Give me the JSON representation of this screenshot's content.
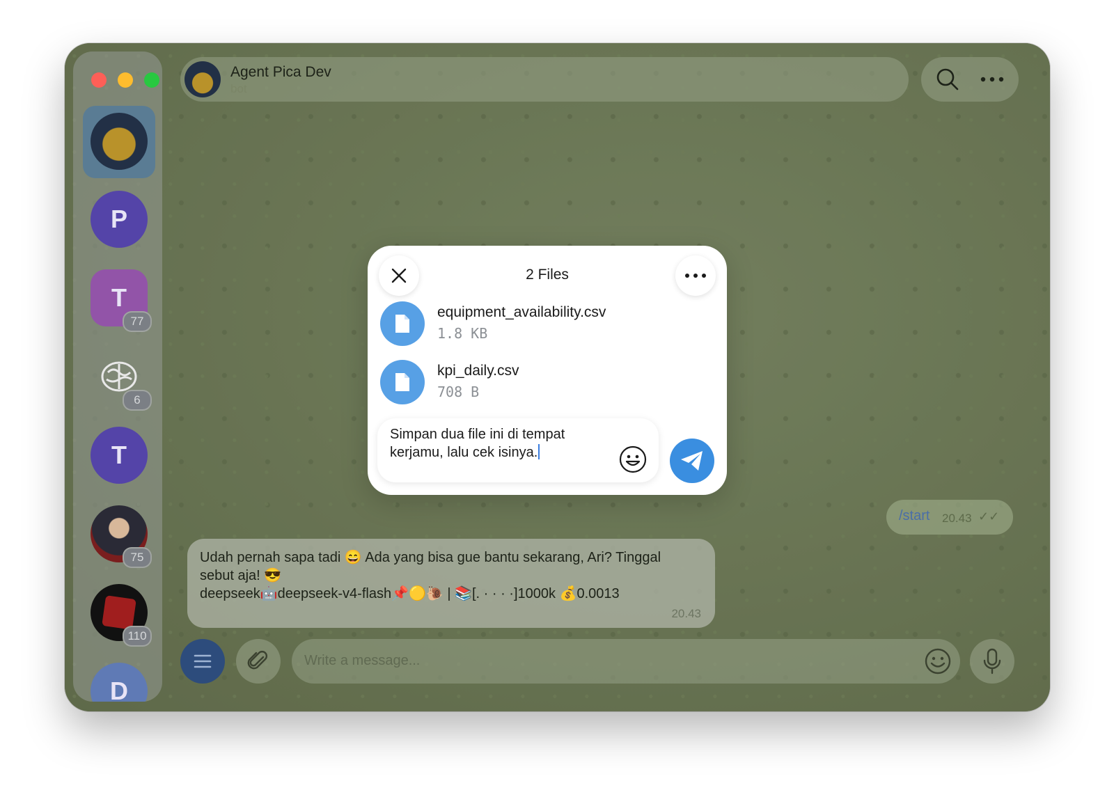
{
  "header": {
    "title": "Agent Pica Dev",
    "subtitle": "bot"
  },
  "sidebar": {
    "items": [
      {
        "name": "Agent Pica Dev",
        "letter": "",
        "badge": ""
      },
      {
        "name": "P",
        "letter": "P",
        "badge": ""
      },
      {
        "name": "T",
        "letter": "T",
        "badge": "77"
      },
      {
        "name": "brain",
        "letter": "",
        "badge": "6"
      },
      {
        "name": "T",
        "letter": "T",
        "badge": ""
      },
      {
        "name": "man",
        "letter": "",
        "badge": "75"
      },
      {
        "name": "dota",
        "letter": "",
        "badge": "110"
      },
      {
        "name": "D",
        "letter": "D",
        "badge": ""
      }
    ]
  },
  "messages": {
    "outgoing": {
      "text": "/start",
      "time": "20.43"
    },
    "incoming": {
      "line1": "Udah pernah sapa tadi 😄 Ada yang bisa gue bantu sekarang, Ari? Tinggal",
      "line2": "sebut aja! 😎",
      "line3": "deepseek🤖deepseek-v4-flash📌🟡🐌 | 📚[.  · · · ·]1000k 💰0.0013",
      "time": "20.43"
    }
  },
  "composer": {
    "placeholder": "Write a message..."
  },
  "modal": {
    "title": "2 Files",
    "files": [
      {
        "name": "equipment_availability.csv",
        "size": "1.8 KB"
      },
      {
        "name": "kpi_daily.csv",
        "size": "708 B"
      }
    ],
    "caption_line1": "Simpan dua file ini di tempat",
    "caption_line2": "kerjamu, lalu cek isinya."
  },
  "colors": {
    "accent": "#3a8ee0",
    "file_icon": "#57a0e5",
    "menu_button": "#2d4c7c"
  }
}
